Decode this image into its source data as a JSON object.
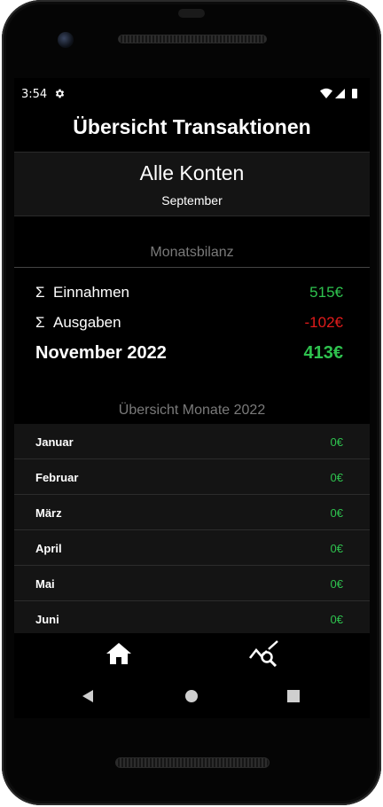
{
  "status": {
    "time": "3:54"
  },
  "header": {
    "title": "Übersicht Transaktionen"
  },
  "account": {
    "name": "Alle Konten",
    "month": "September"
  },
  "balance": {
    "section_title": "Monatsbilanz",
    "income_symbol": "Σ",
    "income_label": "Einnahmen",
    "income_value": "515€",
    "expense_symbol": "Σ",
    "expense_label": "Ausgaben",
    "expense_value": "-102€",
    "total_label": "November 2022",
    "total_value": "413€"
  },
  "months": {
    "section_title": "Übersicht Monate 2022",
    "items": [
      {
        "name": "Januar",
        "value": "0€"
      },
      {
        "name": "Februar",
        "value": "0€"
      },
      {
        "name": "März",
        "value": "0€"
      },
      {
        "name": "April",
        "value": "0€"
      },
      {
        "name": "Mai",
        "value": "0€"
      },
      {
        "name": "Juni",
        "value": "0€"
      }
    ]
  },
  "nav": {
    "items": [
      "home-icon",
      "chart-search-icon"
    ]
  },
  "colors": {
    "positive": "#2ec24e",
    "negative": "#e01b1b",
    "background": "#000000",
    "panel": "#141414"
  }
}
